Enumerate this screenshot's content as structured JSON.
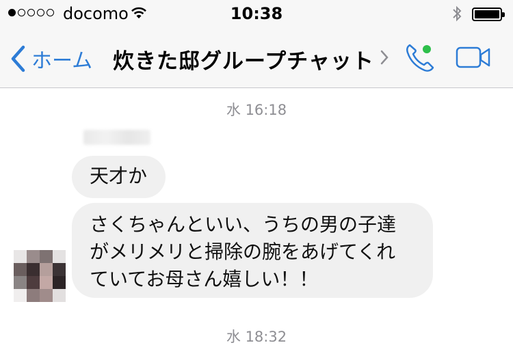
{
  "status_bar": {
    "signal_dots_filled": 1,
    "signal_dots_total": 5,
    "carrier": "docomo",
    "time": "10:38",
    "battery_level": 1.0,
    "icons": [
      "wifi-icon",
      "bluetooth-icon",
      "battery-icon"
    ]
  },
  "nav": {
    "back_label": "ホーム",
    "title": "炊きた邸グループチャット",
    "icons": [
      "chevron-left-icon",
      "chevron-right-icon",
      "phone-icon",
      "video-camera-icon"
    ],
    "online_dot_color": "#2dbf4a"
  },
  "colors": {
    "accent": "#2d7cd6",
    "bubble": "#f0f0f0",
    "timestamp": "#8e8e93"
  },
  "messages": {
    "timestamp_1": "水 16:18",
    "bubble_1": "天才か",
    "bubble_2_lines": [
      "さくちゃんといい、うちの男の子達",
      "がメリメリと掃除の腕をあげてくれ",
      "ていてお母さん嬉しい！！"
    ],
    "timestamp_2": "水 18:32"
  }
}
